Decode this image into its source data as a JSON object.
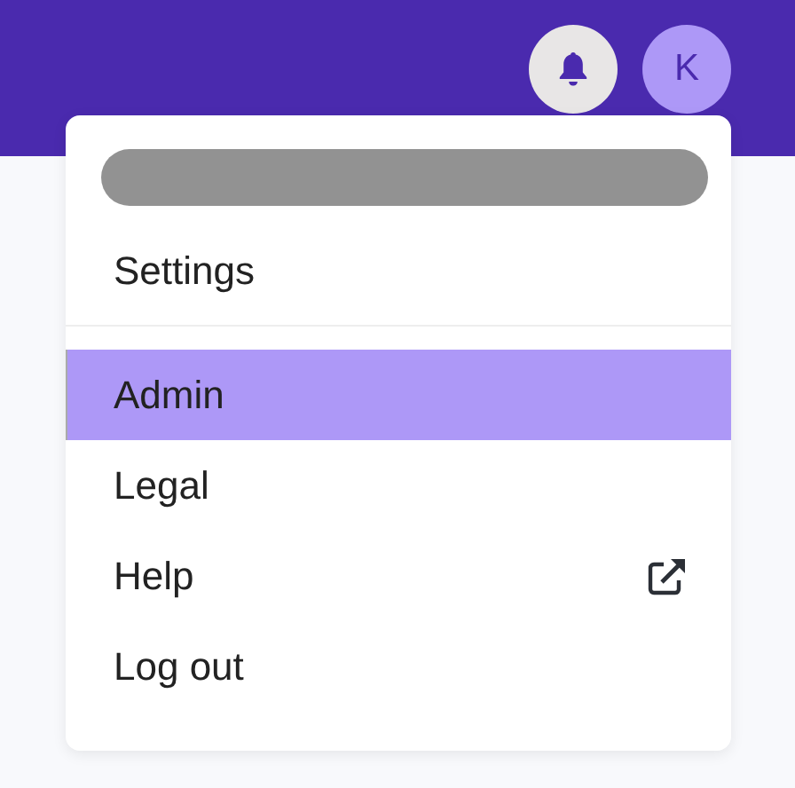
{
  "header": {
    "avatar_initial": "K"
  },
  "menu": {
    "top_items": [
      {
        "label": "Settings",
        "selected": false,
        "external": false
      }
    ],
    "items": [
      {
        "label": "Admin",
        "selected": true,
        "external": false
      },
      {
        "label": "Legal",
        "selected": false,
        "external": false
      },
      {
        "label": "Help",
        "selected": false,
        "external": true
      },
      {
        "label": "Log out",
        "selected": false,
        "external": false
      }
    ]
  }
}
